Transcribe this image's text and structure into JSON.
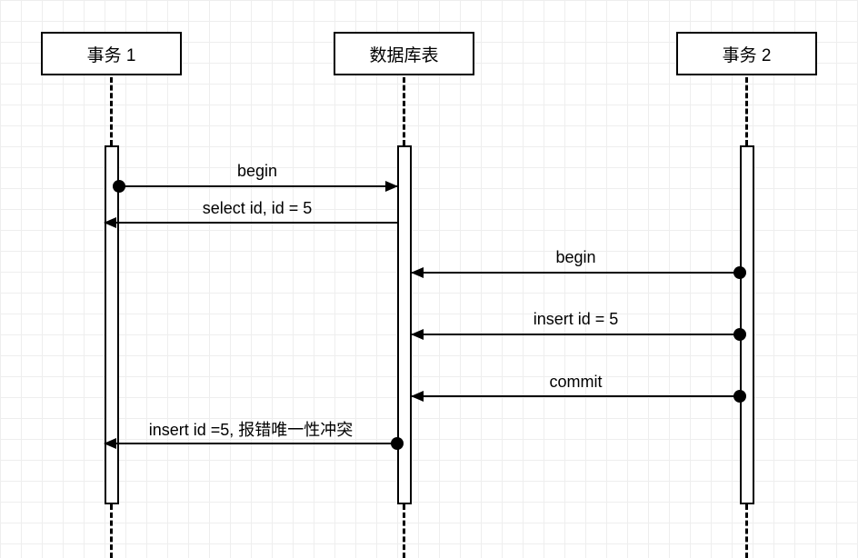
{
  "diagram": {
    "type": "sequence",
    "participants": [
      {
        "id": "tx1",
        "label": "事务 1"
      },
      {
        "id": "db",
        "label": "数据库表"
      },
      {
        "id": "tx2",
        "label": "事务 2"
      }
    ],
    "messages": [
      {
        "from": "tx1",
        "to": "db",
        "label": "begin"
      },
      {
        "from": "db",
        "to": "tx1",
        "label": "select id, id = 5"
      },
      {
        "from": "tx2",
        "to": "db",
        "label": "begin"
      },
      {
        "from": "tx2",
        "to": "db",
        "label": "insert id = 5"
      },
      {
        "from": "tx2",
        "to": "db",
        "label": "commit"
      },
      {
        "from": "db",
        "to": "tx1",
        "label": "insert id =5, 报错唯一性冲突"
      }
    ]
  }
}
